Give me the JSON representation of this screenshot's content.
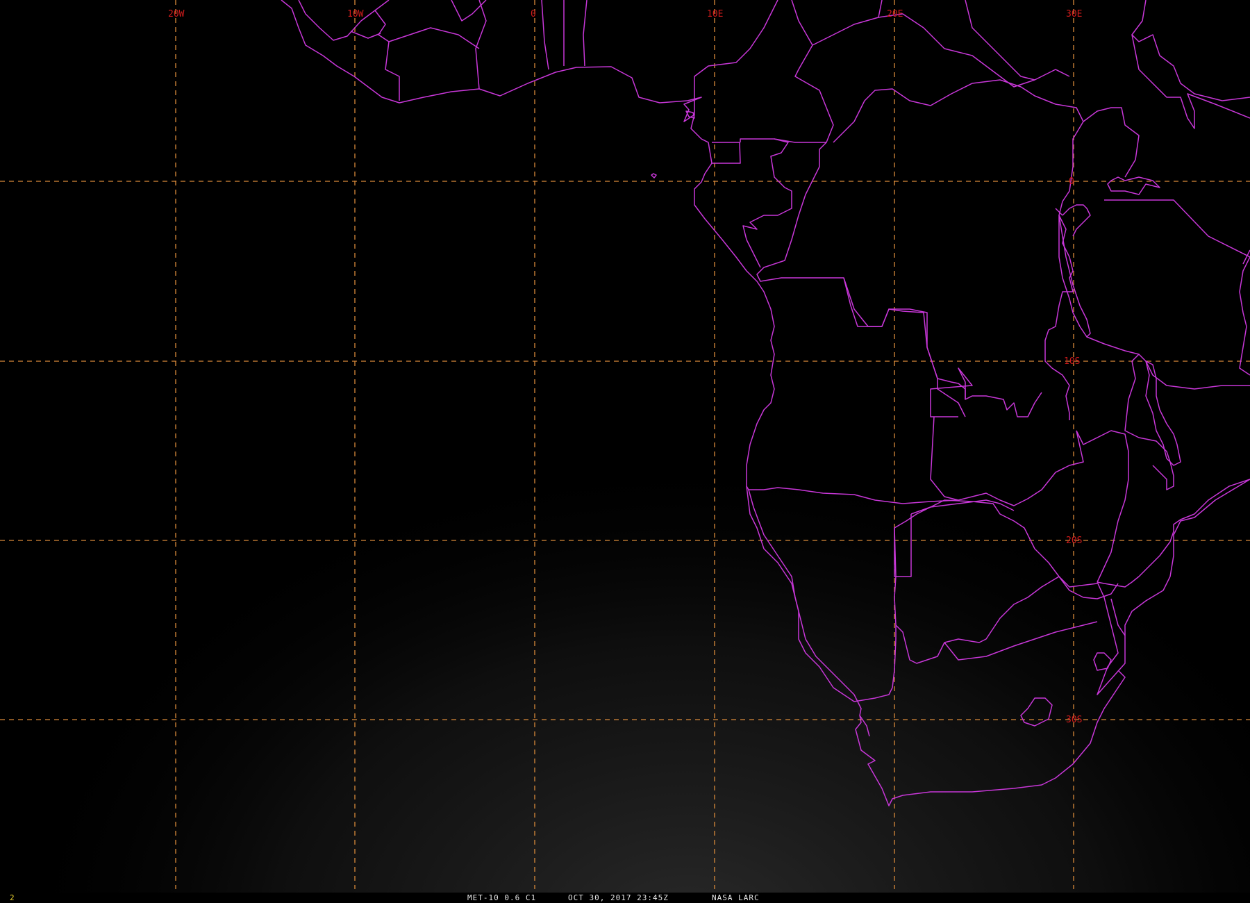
{
  "map": {
    "lon_labels": [
      "20W",
      "10W",
      "0",
      "10E",
      "20E",
      "30E"
    ],
    "lat_labels": [
      "0",
      "10S",
      "20S",
      "30S"
    ],
    "grid_color": "#d98a3a",
    "label_color": "#d01c1c",
    "border_color": "#c837d8",
    "background_color": "#000000"
  },
  "status": {
    "frame_number": "2",
    "satellite_band": "MET-10 0.6 C1",
    "datetime": "OCT 30, 2017 23:45Z",
    "source": "NASA LARC"
  }
}
